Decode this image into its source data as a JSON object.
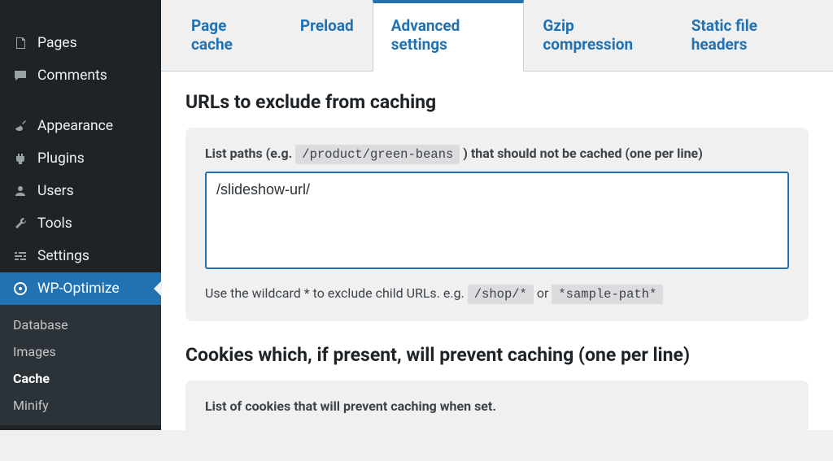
{
  "sidebar": {
    "items": [
      {
        "label": "Pages"
      },
      {
        "label": "Comments"
      },
      {
        "label": "Appearance"
      },
      {
        "label": "Plugins"
      },
      {
        "label": "Users"
      },
      {
        "label": "Tools"
      },
      {
        "label": "Settings"
      },
      {
        "label": "WP-Optimize"
      }
    ],
    "sub": [
      {
        "label": "Database"
      },
      {
        "label": "Images"
      },
      {
        "label": "Cache"
      },
      {
        "label": "Minify"
      }
    ]
  },
  "tabs": {
    "items": [
      {
        "label": "Page cache"
      },
      {
        "label": "Preload"
      },
      {
        "label": "Advanced settings"
      },
      {
        "label": "Gzip compression"
      },
      {
        "label": "Static file headers"
      }
    ]
  },
  "section1": {
    "title": "URLs to exclude from caching",
    "label_pre": "List paths (e.g. ",
    "label_code": "/product/green-beans",
    "label_post": ") that should not be cached (one per line)",
    "textarea_value": "/slideshow-url/",
    "hint_pre": "Use the wildcard * to exclude child URLs. e.g. ",
    "hint_code1": "/shop/*",
    "hint_mid": "  or  ",
    "hint_code2": "*sample-path*"
  },
  "section2": {
    "title": "Cookies which, if present, will prevent caching (one per line)",
    "label": "List of cookies that will prevent caching when set."
  }
}
